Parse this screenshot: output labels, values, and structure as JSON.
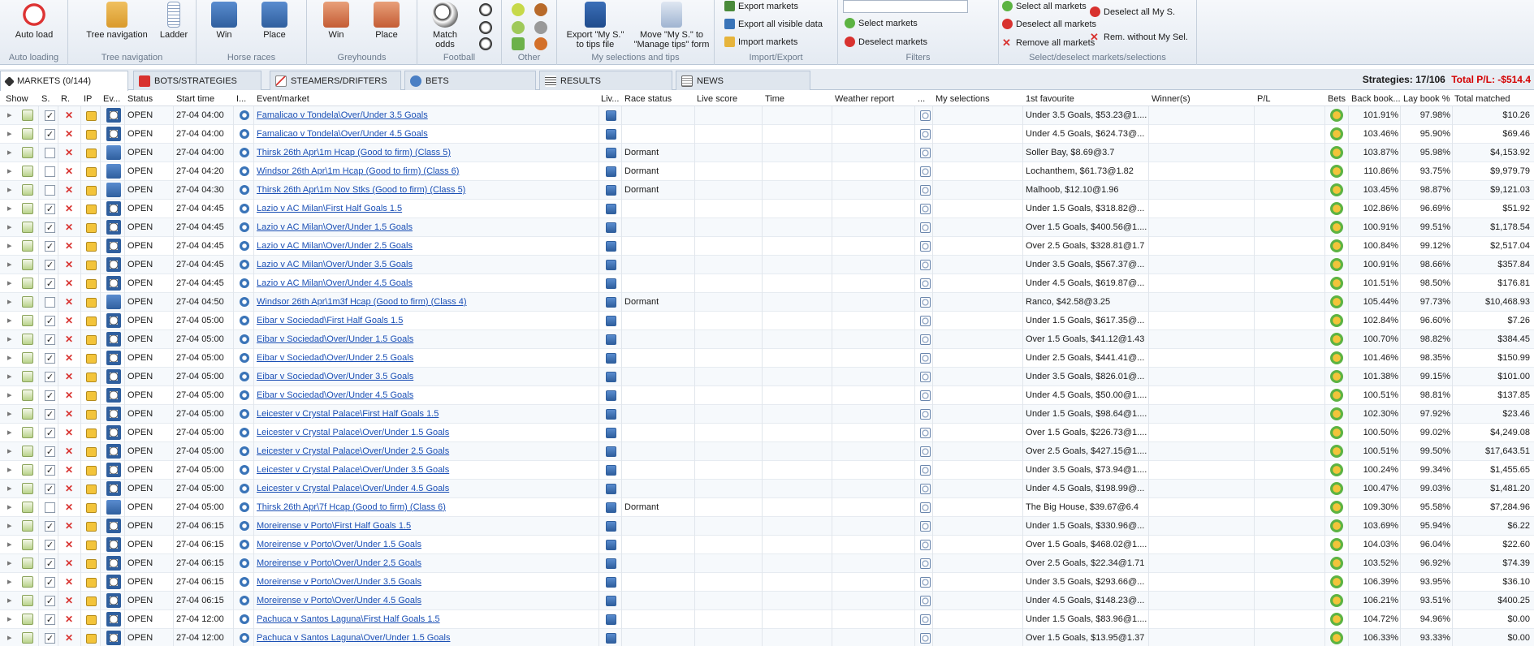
{
  "ribbon": {
    "groups": [
      {
        "label": "Auto loading",
        "buttons": [
          {
            "label": "Auto load"
          }
        ]
      },
      {
        "label": "Tree navigation",
        "buttons": [
          {
            "label": "Tree navigation"
          },
          {
            "label": "Ladder"
          }
        ]
      },
      {
        "label": "Horse races",
        "buttons": [
          {
            "label": "Win"
          },
          {
            "label": "Place"
          }
        ]
      },
      {
        "label": "Greyhounds",
        "buttons": [
          {
            "label": "Win"
          },
          {
            "label": "Place"
          }
        ]
      },
      {
        "label": "Football",
        "buttons": [
          {
            "label": "Match odds"
          }
        ]
      },
      {
        "label": "Other",
        "buttons": []
      },
      {
        "label": "My selections and tips",
        "buttons": [
          {
            "label": "Export \"My S.\" to tips file"
          },
          {
            "label": "Move \"My S.\" to \"Manage tips\" form"
          }
        ]
      },
      {
        "label": "Import/Export",
        "buttons": [
          {
            "label": "Export markets"
          },
          {
            "label": "Export all visible data"
          },
          {
            "label": "Import markets"
          }
        ]
      },
      {
        "label": "Filters",
        "buttons": [
          {
            "label": "Select markets"
          },
          {
            "label": "Deselect markets"
          }
        ]
      },
      {
        "label": "Select/deselect markets/selections",
        "buttons": [
          {
            "label": "Select all markets"
          },
          {
            "label": "Deselect all markets"
          },
          {
            "label": "Remove all markets"
          },
          {
            "label": "Deselect all My S."
          },
          {
            "label": "Rem. without My Sel."
          }
        ]
      }
    ]
  },
  "tabs": [
    {
      "label": "MARKETS (0/144)",
      "icon": "markets-icon"
    },
    {
      "label": "BOTS/STRATEGIES",
      "icon": "bots-icon"
    },
    {
      "label": "STEAMERS/DRIFTERS",
      "icon": "chart-icon"
    },
    {
      "label": "BETS",
      "icon": "bets-icon"
    },
    {
      "label": "RESULTS",
      "icon": "results-icon"
    },
    {
      "label": "NEWS",
      "icon": "news-icon"
    }
  ],
  "status": {
    "strategies": "Strategies: 17/106",
    "pl": "Total P/L: -$514.4"
  },
  "colors": {
    "accent": "#1a4fb5",
    "pl_negative": "#d40000",
    "header_bg": "#e4eaf2"
  },
  "columns": [
    "Show",
    "S.",
    "R.",
    "IP",
    "Ev...",
    "Status",
    "Start time",
    "I...",
    "Event/market",
    "Liv...",
    "Race status",
    "Live score",
    "Time",
    "Weather report",
    "...",
    "My selections",
    "1st favourite",
    "Winner(s)",
    "P/L",
    "Bets",
    "Back book...",
    "Lay book %",
    "Total matched"
  ],
  "rows": [
    {
      "s": true,
      "ev": "football",
      "status": "OPEN",
      "time": "27-04 04:00",
      "market": "Famalicao v Tondela\\Over/Under 3.5 Goals",
      "race": "",
      "fav": "Under 3.5 Goals, $53.23@1....",
      "back": "101.91%",
      "lay": "97.98%",
      "matched": "$10.26"
    },
    {
      "s": true,
      "ev": "football",
      "status": "OPEN",
      "time": "27-04 04:00",
      "market": "Famalicao v Tondela\\Over/Under 4.5 Goals",
      "race": "",
      "fav": "Under 4.5 Goals, $624.73@...",
      "back": "103.46%",
      "lay": "95.90%",
      "matched": "$69.46"
    },
    {
      "s": false,
      "ev": "horse",
      "status": "OPEN",
      "time": "27-04 04:00",
      "market": "Thirsk 26th Apr\\1m Hcap (Good to firm) (Class 5)",
      "race": "Dormant",
      "fav": "Soller Bay, $8.69@3.7",
      "back": "103.87%",
      "lay": "95.98%",
      "matched": "$4,153.92"
    },
    {
      "s": false,
      "ev": "horse",
      "status": "OPEN",
      "time": "27-04 04:20",
      "market": "Windsor 26th Apr\\1m Hcap (Good to firm) (Class 6)",
      "race": "Dormant",
      "fav": "Lochanthem, $61.73@1.82",
      "back": "110.86%",
      "lay": "93.75%",
      "matched": "$9,979.79"
    },
    {
      "s": false,
      "ev": "horse",
      "status": "OPEN",
      "time": "27-04 04:30",
      "market": "Thirsk 26th Apr\\1m Nov Stks (Good to firm) (Class 5)",
      "race": "Dormant",
      "fav": "Malhoob, $12.10@1.96",
      "back": "103.45%",
      "lay": "98.87%",
      "matched": "$9,121.03"
    },
    {
      "s": true,
      "ev": "football",
      "status": "OPEN",
      "time": "27-04 04:45",
      "market": "Lazio v AC Milan\\First Half Goals 1.5",
      "race": "",
      "fav": "Under 1.5 Goals, $318.82@...",
      "back": "102.86%",
      "lay": "96.69%",
      "matched": "$51.92"
    },
    {
      "s": true,
      "ev": "football",
      "status": "OPEN",
      "time": "27-04 04:45",
      "market": "Lazio v AC Milan\\Over/Under 1.5 Goals",
      "race": "",
      "fav": "Over 1.5 Goals, $400.56@1....",
      "back": "100.91%",
      "lay": "99.51%",
      "matched": "$1,178.54"
    },
    {
      "s": true,
      "ev": "football",
      "status": "OPEN",
      "time": "27-04 04:45",
      "market": "Lazio v AC Milan\\Over/Under 2.5 Goals",
      "race": "",
      "fav": "Over 2.5 Goals, $328.81@1.7",
      "back": "100.84%",
      "lay": "99.12%",
      "matched": "$2,517.04"
    },
    {
      "s": true,
      "ev": "football",
      "status": "OPEN",
      "time": "27-04 04:45",
      "market": "Lazio v AC Milan\\Over/Under 3.5 Goals",
      "race": "",
      "fav": "Under 3.5 Goals, $567.37@...",
      "back": "100.91%",
      "lay": "98.66%",
      "matched": "$357.84"
    },
    {
      "s": true,
      "ev": "football",
      "status": "OPEN",
      "time": "27-04 04:45",
      "market": "Lazio v AC Milan\\Over/Under 4.5 Goals",
      "race": "",
      "fav": "Under 4.5 Goals, $619.87@...",
      "back": "101.51%",
      "lay": "98.50%",
      "matched": "$176.81"
    },
    {
      "s": false,
      "ev": "horse",
      "status": "OPEN",
      "time": "27-04 04:50",
      "market": "Windsor 26th Apr\\1m3f Hcap (Good to firm) (Class 4)",
      "race": "Dormant",
      "fav": "Ranco, $42.58@3.25",
      "back": "105.44%",
      "lay": "97.73%",
      "matched": "$10,468.93"
    },
    {
      "s": true,
      "ev": "football",
      "status": "OPEN",
      "time": "27-04 05:00",
      "market": "Eibar v Sociedad\\First Half Goals 1.5",
      "race": "",
      "fav": "Under 1.5 Goals, $617.35@...",
      "back": "102.84%",
      "lay": "96.60%",
      "matched": "$7.26"
    },
    {
      "s": true,
      "ev": "football",
      "status": "OPEN",
      "time": "27-04 05:00",
      "market": "Eibar v Sociedad\\Over/Under 1.5 Goals",
      "race": "",
      "fav": "Over 1.5 Goals, $41.12@1.43",
      "back": "100.70%",
      "lay": "98.82%",
      "matched": "$384.45"
    },
    {
      "s": true,
      "ev": "football",
      "status": "OPEN",
      "time": "27-04 05:00",
      "market": "Eibar v Sociedad\\Over/Under 2.5 Goals",
      "race": "",
      "fav": "Under 2.5 Goals, $441.41@...",
      "back": "101.46%",
      "lay": "98.35%",
      "matched": "$150.99"
    },
    {
      "s": true,
      "ev": "football",
      "status": "OPEN",
      "time": "27-04 05:00",
      "market": "Eibar v Sociedad\\Over/Under 3.5 Goals",
      "race": "",
      "fav": "Under 3.5 Goals, $826.01@...",
      "back": "101.38%",
      "lay": "99.15%",
      "matched": "$101.00"
    },
    {
      "s": true,
      "ev": "football",
      "status": "OPEN",
      "time": "27-04 05:00",
      "market": "Eibar v Sociedad\\Over/Under 4.5 Goals",
      "race": "",
      "fav": "Under 4.5 Goals, $50.00@1....",
      "back": "100.51%",
      "lay": "98.81%",
      "matched": "$137.85"
    },
    {
      "s": true,
      "ev": "football",
      "status": "OPEN",
      "time": "27-04 05:00",
      "market": "Leicester v Crystal Palace\\First Half Goals 1.5",
      "race": "",
      "fav": "Under 1.5 Goals, $98.64@1....",
      "back": "102.30%",
      "lay": "97.92%",
      "matched": "$23.46"
    },
    {
      "s": true,
      "ev": "football",
      "status": "OPEN",
      "time": "27-04 05:00",
      "market": "Leicester v Crystal Palace\\Over/Under 1.5 Goals",
      "race": "",
      "fav": "Over 1.5 Goals, $226.73@1....",
      "back": "100.50%",
      "lay": "99.02%",
      "matched": "$4,249.08"
    },
    {
      "s": true,
      "ev": "football",
      "status": "OPEN",
      "time": "27-04 05:00",
      "market": "Leicester v Crystal Palace\\Over/Under 2.5 Goals",
      "race": "",
      "fav": "Over 2.5 Goals, $427.15@1....",
      "back": "100.51%",
      "lay": "99.50%",
      "matched": "$17,643.51"
    },
    {
      "s": true,
      "ev": "football",
      "status": "OPEN",
      "time": "27-04 05:00",
      "market": "Leicester v Crystal Palace\\Over/Under 3.5 Goals",
      "race": "",
      "fav": "Under 3.5 Goals, $73.94@1....",
      "back": "100.24%",
      "lay": "99.34%",
      "matched": "$1,455.65"
    },
    {
      "s": true,
      "ev": "football",
      "status": "OPEN",
      "time": "27-04 05:00",
      "market": "Leicester v Crystal Palace\\Over/Under 4.5 Goals",
      "race": "",
      "fav": "Under 4.5 Goals, $198.99@...",
      "back": "100.47%",
      "lay": "99.03%",
      "matched": "$1,481.20"
    },
    {
      "s": false,
      "ev": "horse",
      "status": "OPEN",
      "time": "27-04 05:00",
      "market": "Thirsk 26th Apr\\7f Hcap (Good to firm) (Class 6)",
      "race": "Dormant",
      "fav": "The Big House, $39.67@6.4",
      "back": "109.30%",
      "lay": "95.58%",
      "matched": "$7,284.96"
    },
    {
      "s": true,
      "ev": "football",
      "status": "OPEN",
      "time": "27-04 06:15",
      "market": "Moreirense v Porto\\First Half Goals 1.5",
      "race": "",
      "fav": "Under 1.5 Goals, $330.96@...",
      "back": "103.69%",
      "lay": "95.94%",
      "matched": "$6.22"
    },
    {
      "s": true,
      "ev": "football",
      "status": "OPEN",
      "time": "27-04 06:15",
      "market": "Moreirense v Porto\\Over/Under 1.5 Goals",
      "race": "",
      "fav": "Over 1.5 Goals, $468.02@1....",
      "back": "104.03%",
      "lay": "96.04%",
      "matched": "$22.60"
    },
    {
      "s": true,
      "ev": "football",
      "status": "OPEN",
      "time": "27-04 06:15",
      "market": "Moreirense v Porto\\Over/Under 2.5 Goals",
      "race": "",
      "fav": "Over 2.5 Goals, $22.34@1.71",
      "back": "103.52%",
      "lay": "96.92%",
      "matched": "$74.39"
    },
    {
      "s": true,
      "ev": "football",
      "status": "OPEN",
      "time": "27-04 06:15",
      "market": "Moreirense v Porto\\Over/Under 3.5 Goals",
      "race": "",
      "fav": "Under 3.5 Goals, $293.66@...",
      "back": "106.39%",
      "lay": "93.95%",
      "matched": "$36.10"
    },
    {
      "s": true,
      "ev": "football",
      "status": "OPEN",
      "time": "27-04 06:15",
      "market": "Moreirense v Porto\\Over/Under 4.5 Goals",
      "race": "",
      "fav": "Under 4.5 Goals, $148.23@...",
      "back": "106.21%",
      "lay": "93.51%",
      "matched": "$400.25"
    },
    {
      "s": true,
      "ev": "football",
      "status": "OPEN",
      "time": "27-04 12:00",
      "market": "Pachuca v Santos Laguna\\First Half Goals 1.5",
      "race": "",
      "fav": "Under 1.5 Goals, $83.96@1....",
      "back": "104.72%",
      "lay": "94.96%",
      "matched": "$0.00"
    },
    {
      "s": true,
      "ev": "football",
      "status": "OPEN",
      "time": "27-04 12:00",
      "market": "Pachuca v Santos Laguna\\Over/Under 1.5 Goals",
      "race": "",
      "fav": "Over 1.5 Goals, $13.95@1.37",
      "back": "106.33%",
      "lay": "93.33%",
      "matched": "$0.00"
    }
  ]
}
